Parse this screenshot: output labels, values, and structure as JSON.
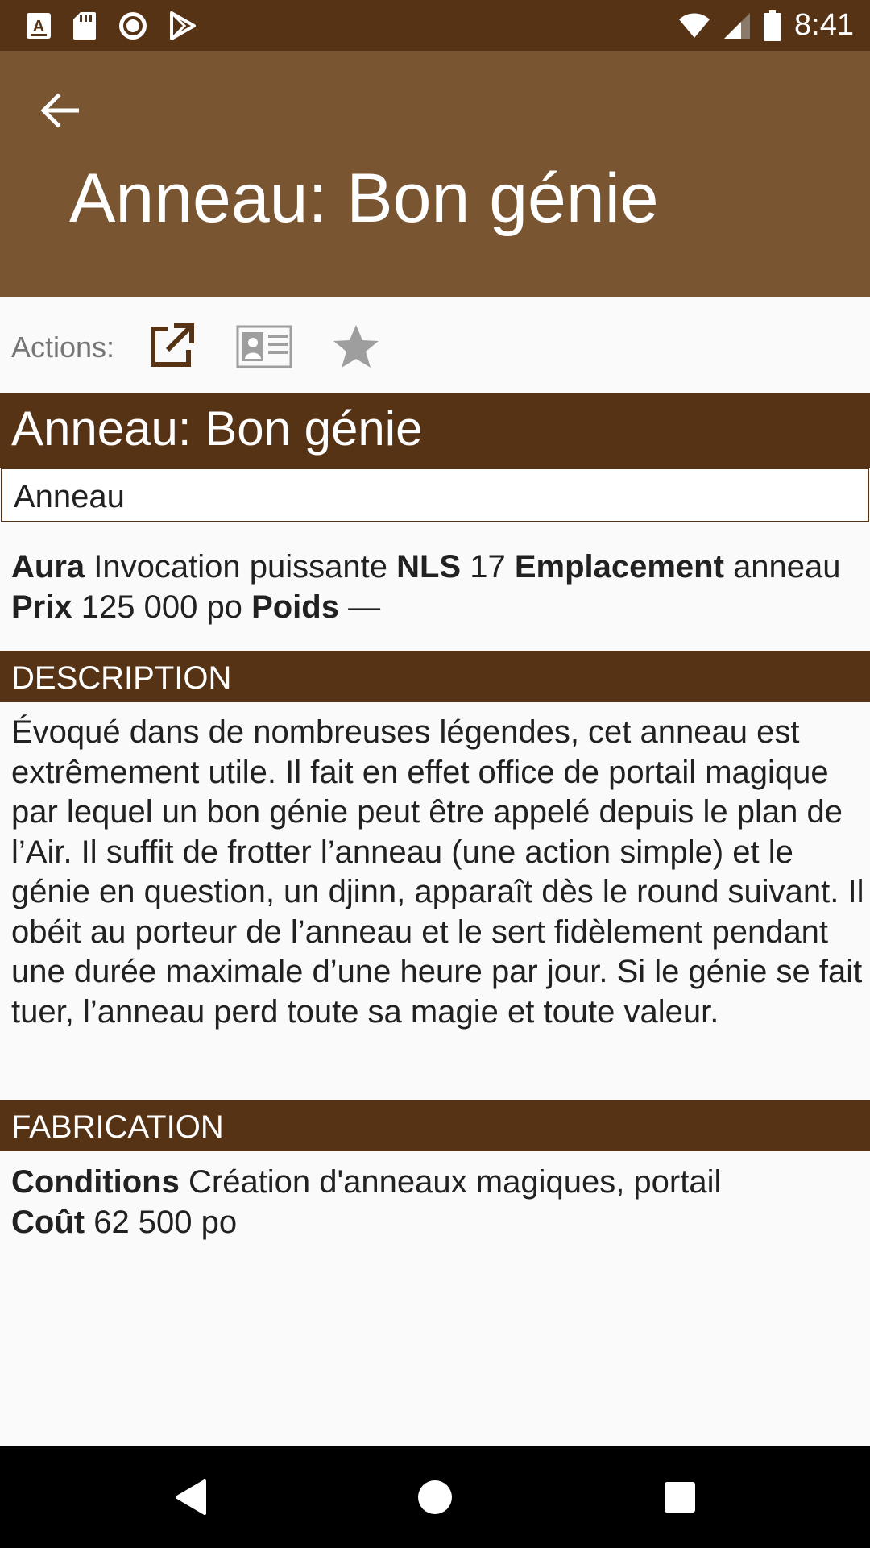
{
  "status_bar": {
    "time": "8:41",
    "left_icons": [
      "a-notification-icon",
      "sd-card-icon",
      "record-icon",
      "play-store-icon"
    ],
    "right_icons": [
      "wifi-icon",
      "signal-icon",
      "battery-icon"
    ]
  },
  "app_bar": {
    "title": "Anneau: Bon génie",
    "back_icon": "arrow-left-icon"
  },
  "actions": {
    "label": "Actions:",
    "buttons": [
      "open-external-icon",
      "id-card-icon",
      "star-icon"
    ]
  },
  "item": {
    "title": "Anneau: Bon génie",
    "type": "Anneau",
    "stats": {
      "aura_label": "Aura",
      "aura_value": "Invocation puissante",
      "nls_label": "NLS",
      "nls_value": "17",
      "slot_label": "Emplacement",
      "slot_value": "anneau",
      "price_label": "Prix",
      "price_value": "125 000 po",
      "weight_label": "Poids",
      "weight_value": "—"
    },
    "description_header": "DESCRIPTION",
    "description": "Évoqué dans de nombreuses légendes, cet anneau est extrêmement utile. Il fait en effet office de portail magique par lequel un bon génie peut être appelé depuis le plan de l’Air. Il suffit de frotter l’anneau (une action simple) et le génie en question, un djinn, apparaît dès le round suivant. Il obéit au porteur de l’anneau et le sert fidèlement pendant une durée maximale d’une heure par jour. Si le génie se fait tuer, l’anneau perd toute sa magie et toute valeur.",
    "fabrication_header": "FABRICATION",
    "fabrication": {
      "conditions_label": "Conditions",
      "conditions_value": "Création d'anneaux magiques, portail",
      "cost_label": "Coût",
      "cost_value": "62 500 po"
    }
  },
  "colors": {
    "status_bar": "#563315",
    "app_bar": "#7A5531",
    "section_header": "#563315",
    "action_icon_active": "#563315",
    "action_icon_inactive": "#9E9E9E"
  },
  "nav_bar": {
    "buttons": [
      "back-triangle-icon",
      "home-circle-icon",
      "recents-square-icon"
    ]
  }
}
